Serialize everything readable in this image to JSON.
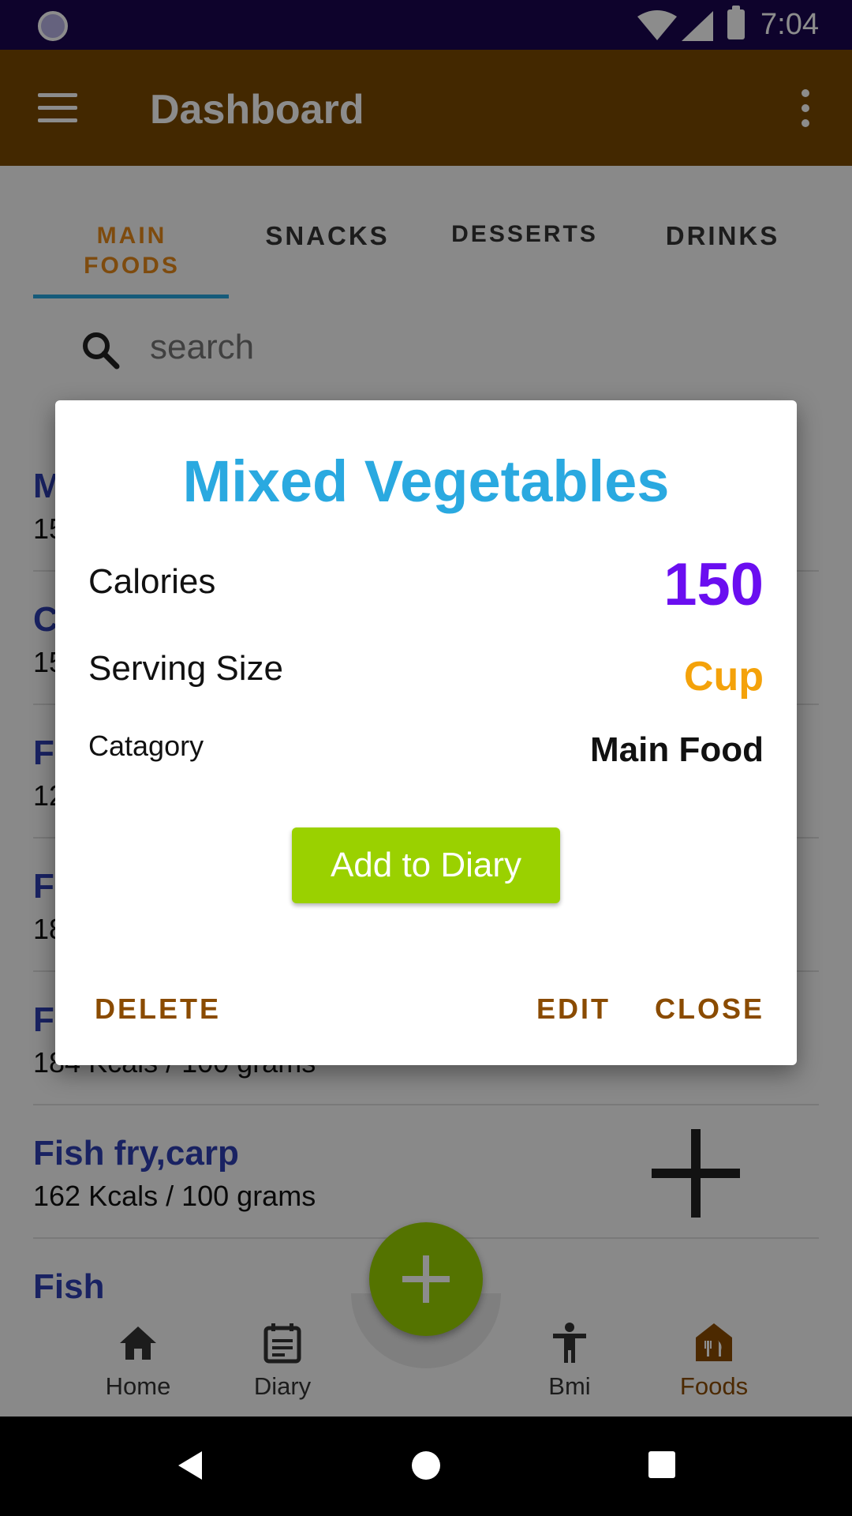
{
  "status_bar": {
    "time": "7:04"
  },
  "app_bar": {
    "title": "Dashboard"
  },
  "tabs": [
    {
      "label": "MAIN FOODS",
      "active": true
    },
    {
      "label": "SNACKS",
      "active": false
    },
    {
      "label": "DESSERTS",
      "active": false
    },
    {
      "label": "DRINKS",
      "active": false
    }
  ],
  "search": {
    "placeholder": "search"
  },
  "list": [
    {
      "name": "M",
      "kcal": "15"
    },
    {
      "name": "C",
      "kcal": "15"
    },
    {
      "name": "F",
      "kcal": "12"
    },
    {
      "name": "F",
      "kcal": "18"
    },
    {
      "name": "F",
      "kcal": "184 Kcals / 100 grams"
    },
    {
      "name": "Fish fry,carp",
      "kcal": "162 Kcals / 100 grams"
    },
    {
      "name": "Fish",
      "kcal": ""
    }
  ],
  "bottom_nav": {
    "items": [
      {
        "label": "Home",
        "icon": "home-icon"
      },
      {
        "label": "Diary",
        "icon": "diary-icon"
      },
      {
        "label": "Bmi",
        "icon": "person-icon"
      },
      {
        "label": "Foods",
        "icon": "restaurant-icon",
        "active": true
      }
    ]
  },
  "dialog": {
    "title": "Mixed Vegetables",
    "calories_label": "Calories",
    "calories_value": "150",
    "serving_label": "Serving Size",
    "serving_value": "Cup",
    "category_label": "Catagory",
    "category_value": "Main Food",
    "add_button": "Add to Diary",
    "delete": "DELETE",
    "edit": "EDIT",
    "close": "CLOSE"
  },
  "colors": {
    "status_bar": "#1a0750",
    "app_bar": "#7a4a00",
    "accent": "#e6891b",
    "title": "#2aa9e0",
    "calories": "#6a0ef0",
    "serving": "#f4a20a",
    "add_button": "#9ad100"
  }
}
